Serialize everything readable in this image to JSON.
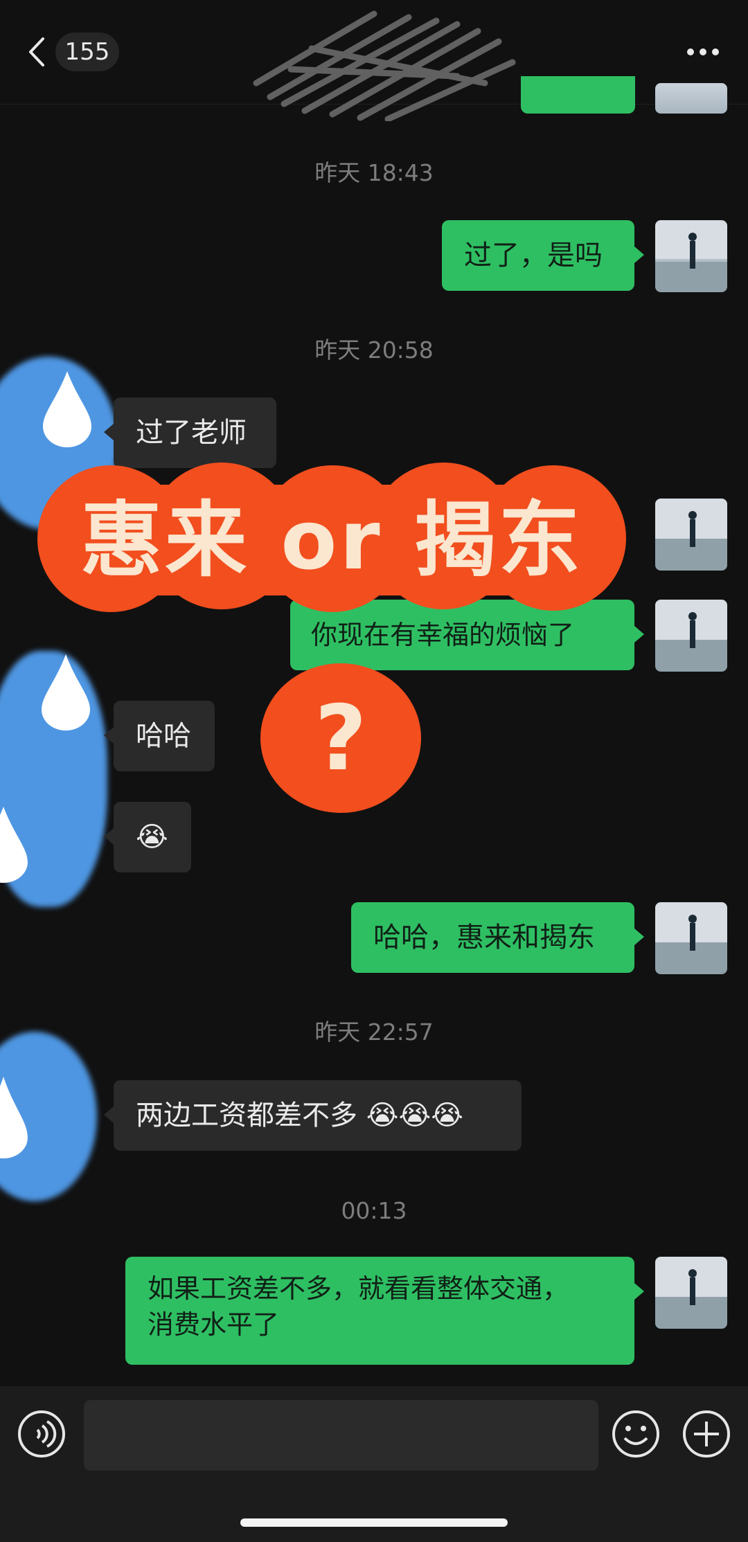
{
  "header": {
    "unread_count": "155",
    "back_icon": "chevron-left-icon",
    "more_icon": "ellipsis-icon"
  },
  "timestamps": {
    "t1": "昨天 18:43",
    "t2": "昨天 20:58",
    "t3": "昨天 22:57",
    "t4": "00:13"
  },
  "messages": {
    "m1": "过了，是吗",
    "m2": "过了老师",
    "m3": "你现在有幸福的烦恼了",
    "m4": "哈哈",
    "m5": "😭",
    "m6": "哈哈，惠来和揭东",
    "m7": "两边工资都差不多 😭😭😭",
    "m8_line1": "如果工资差不多，就看看整体交通，",
    "m8_line2": "消费水平了"
  },
  "overlay": {
    "title": "惠来 or 揭东",
    "question": "?"
  },
  "input_bar": {
    "placeholder": "",
    "voice_icon": "voice-icon",
    "emoji_icon": "emoji-icon",
    "plus_icon": "plus-icon"
  },
  "colors": {
    "background": "#111111",
    "my_bubble": "#2fbf63",
    "their_bubble": "#2a2a2a",
    "overlay_red": "#f24e1e",
    "overlay_text": "#fbe6cf",
    "blur_blue": "#4e96e2"
  }
}
